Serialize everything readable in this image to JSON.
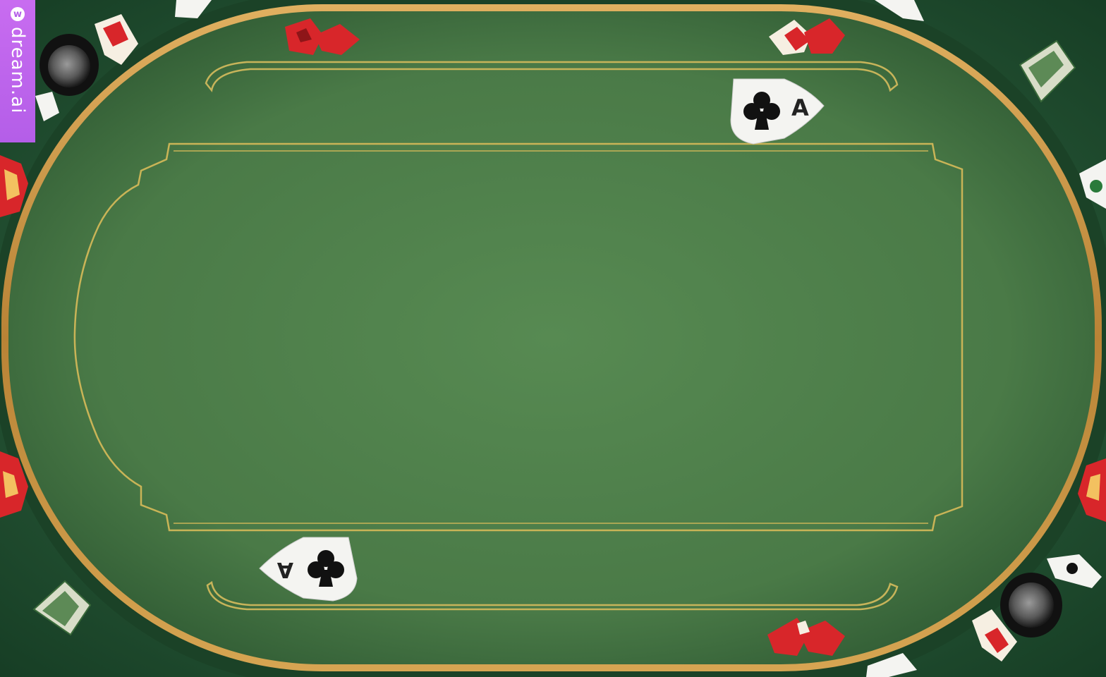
{
  "watermark": {
    "logo": "w",
    "text": "dream.ai"
  },
  "colors": {
    "felt": "#4f7f4b",
    "felt_edge": "#2f5a33",
    "rail_gold": "#c9953f",
    "outer_green": "#1f4a2d",
    "chip_red": "#d8262a",
    "card_white": "#f4f4f1",
    "watermark_purple": "#b45ee8"
  },
  "table": {
    "cards": [
      {
        "rank": "A",
        "suit": "club"
      },
      {
        "rank": "A",
        "suit": "club"
      }
    ],
    "icons": [
      "card-red-hearts-icon",
      "chip-icon",
      "playing-card-icon",
      "cup-holder-icon"
    ]
  }
}
